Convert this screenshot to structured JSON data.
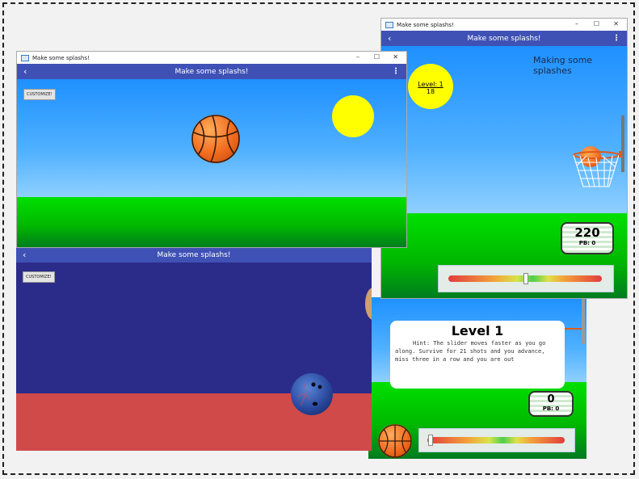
{
  "app": {
    "window_title": "Make some splashs!",
    "appbar_title": "Make some splashs!",
    "back_glyph": "‹",
    "menu_glyph": "⋮",
    "window_controls": {
      "minimize": "–",
      "maximize": "☐",
      "close": "✕"
    }
  },
  "window_a": {
    "customize_label": "CUSTOMIZE!"
  },
  "window_b": {
    "status_text": "Making some splashes",
    "level_label": "Level: 1",
    "level_count": "18",
    "score": "220",
    "personal_best": "PB: 0",
    "slider_level": 0.5
  },
  "window_c": {
    "customize_label": "CUSTOMIZE!"
  },
  "window_d": {
    "dialog_title": "Level 1",
    "dialog_hint": "Hint: The slider moves faster as you go along. Survive for 21 shots and you advance, miss three in a row and you are out",
    "score": "0",
    "personal_best": "PB: 0",
    "slider_level": 0.02
  },
  "colors": {
    "appbar": "#3f51b5",
    "sun": "#ffff00",
    "ball": "#f06a1d",
    "bowling_top": "#2b2b8a",
    "bowling_floor": "#d04a4a"
  }
}
